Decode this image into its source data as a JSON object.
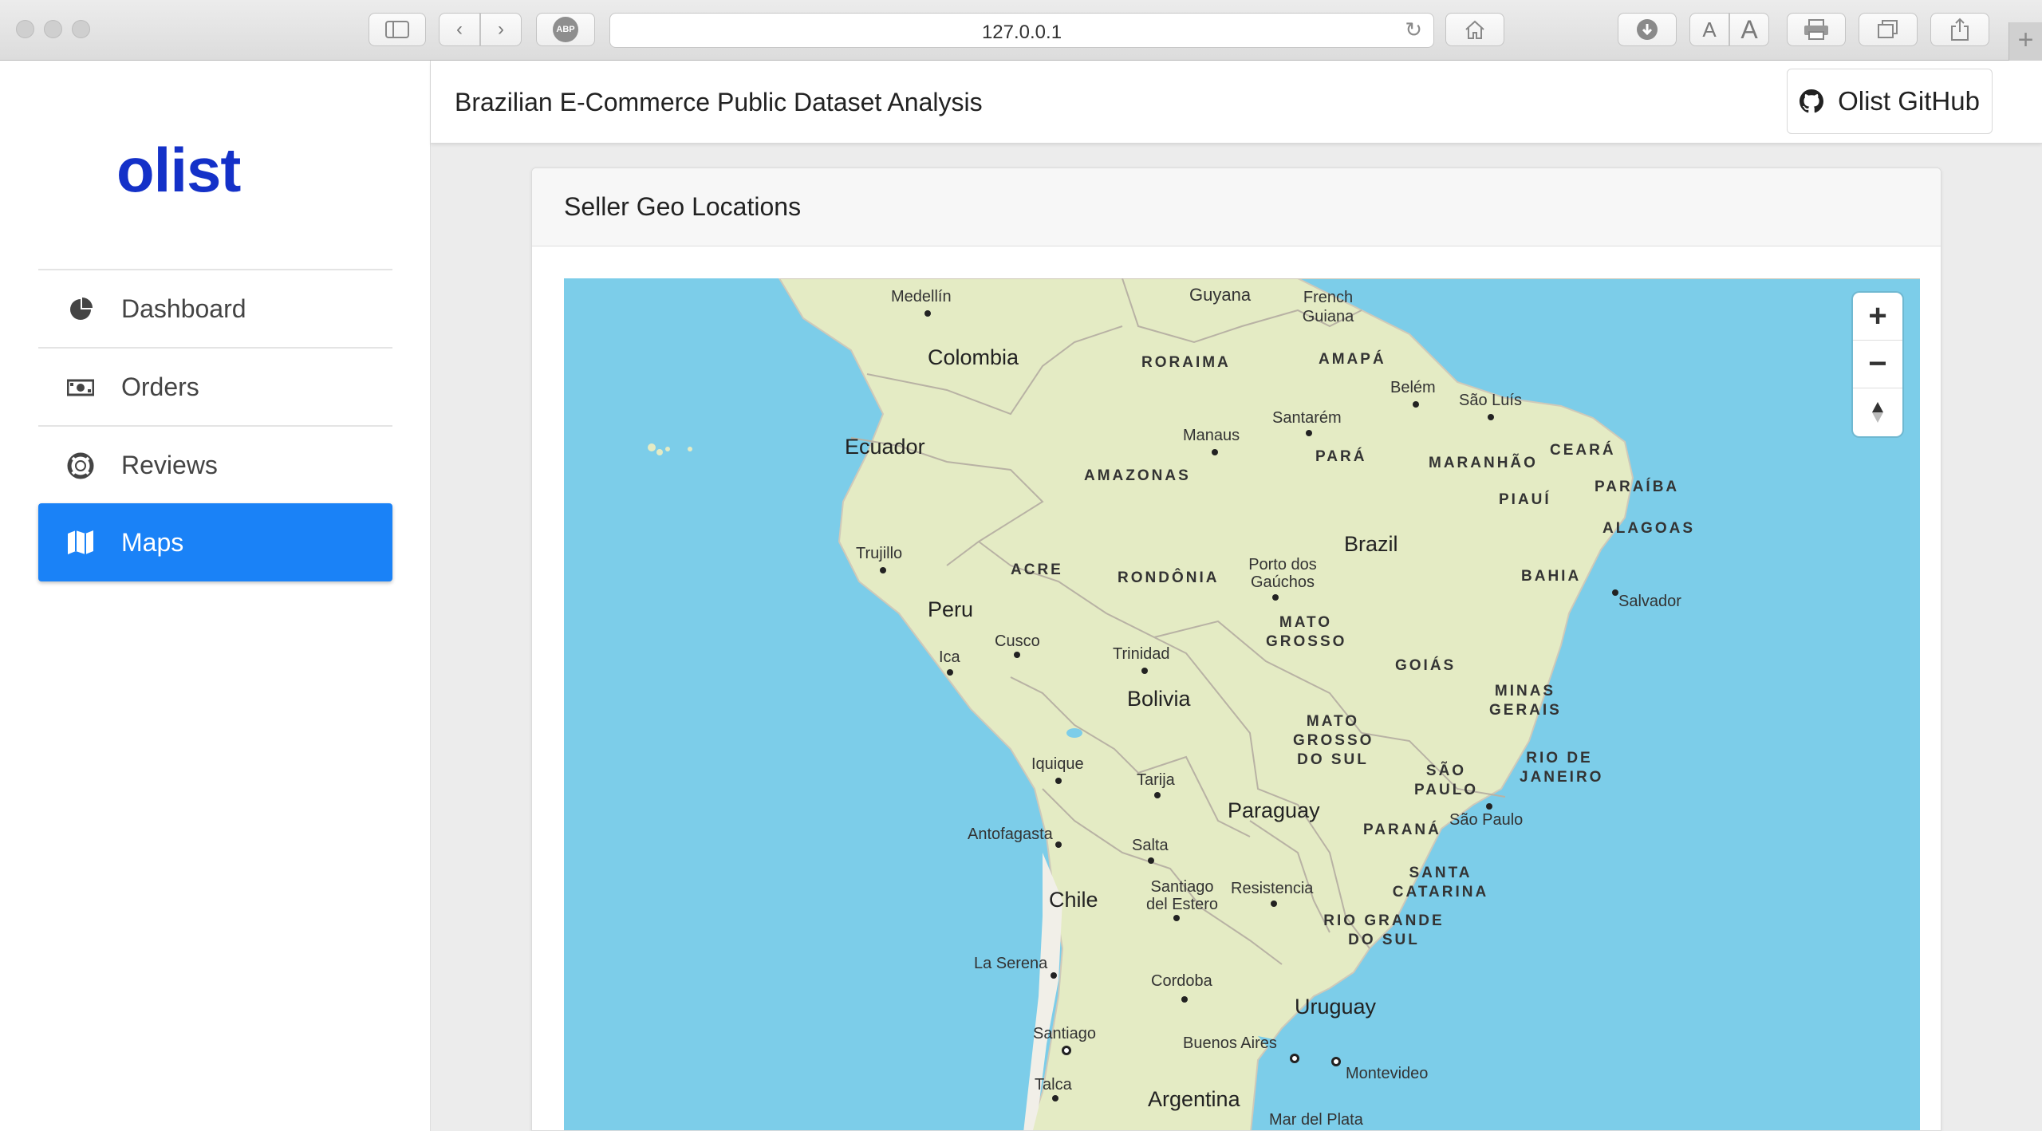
{
  "browser": {
    "url": "127.0.0.1"
  },
  "sidebar": {
    "logo": "olist",
    "items": [
      {
        "label": "Dashboard",
        "icon": "pie-chart-icon",
        "active": false
      },
      {
        "label": "Orders",
        "icon": "money-icon",
        "active": false
      },
      {
        "label": "Reviews",
        "icon": "life-ring-icon",
        "active": false
      },
      {
        "label": "Maps",
        "icon": "map-icon",
        "active": true
      }
    ]
  },
  "header": {
    "title": "Brazilian E-Commerce Public Dataset Analysis",
    "github_label": "Olist GitHub"
  },
  "card": {
    "title": "Seller Geo Locations"
  },
  "colors": {
    "accent": "#1a82f7",
    "logo": "#1431c8",
    "water": "#7ccde9",
    "land": "#e4ebc4"
  },
  "map": {
    "countries": [
      "Colombia",
      "Ecuador",
      "Peru",
      "Brazil",
      "Bolivia",
      "Paraguay",
      "Chile",
      "Uruguay",
      "Argentina",
      "Guyana",
      "French Guiana"
    ],
    "states": [
      "RORAIMA",
      "AMAPÁ",
      "AMAZONAS",
      "PARÁ",
      "MARANHÃO",
      "CEARÁ",
      "PIAUÍ",
      "PARAÍBA",
      "ALAGOAS",
      "ACRE",
      "RONDÔNIA",
      "BAHIA",
      "MATO GROSSO",
      "GOIÁS",
      "MINAS GERAIS",
      "MATO GROSSO DO SUL",
      "SÃO PAULO",
      "RIO DE JANEIRO",
      "PARANÁ",
      "SANTA CATARINA",
      "RIO GRANDE DO SUL"
    ],
    "cities": [
      "Medellín",
      "Belém",
      "São Luís",
      "Santarém",
      "Manaus",
      "Trujillo",
      "Porto dos Gaúchos",
      "Salvador",
      "Cusco",
      "Ica",
      "Trinidad",
      "Iquique",
      "Tarija",
      "São Paulo",
      "Antofagasta",
      "Salta",
      "Santiago del Estero",
      "Resistencia",
      "La Serena",
      "Cordoba",
      "Santiago",
      "Buenos Aires",
      "Montevideo",
      "Talca",
      "Mar del Plata"
    ],
    "zoom_in": "+",
    "zoom_out": "−",
    "compass": "▲"
  }
}
